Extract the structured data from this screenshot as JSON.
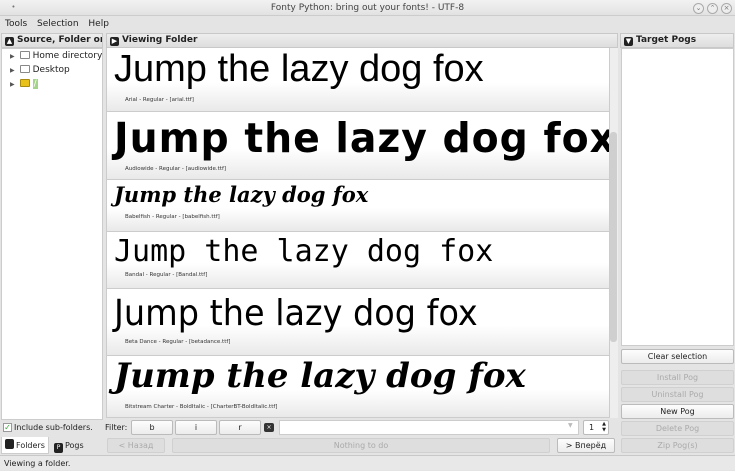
{
  "window": {
    "title": "Fonty Python: bring out your fonts!  -  UTF-8"
  },
  "menu": [
    "Tools",
    "Selection",
    "Help"
  ],
  "left": {
    "title": "Source, Folder or Pog",
    "tree": [
      "Home directory",
      "Desktop",
      "/"
    ],
    "include_subfolders": "Include sub-folders.",
    "include_checked": true,
    "tabs": [
      "Folders",
      "Pogs"
    ]
  },
  "center": {
    "title": "Viewing Folder",
    "sample_text": "Jump the lazy dog fox",
    "fonts": [
      {
        "caption": "Arial - Regular - [arial.ttf]"
      },
      {
        "caption": "Audiowide - Regular - [audiowide.ttf]"
      },
      {
        "caption": "Babelfish - Regular - [babelfish.ttf]"
      },
      {
        "caption": "Bandal - Regular - [Bandal.ttf]"
      },
      {
        "caption": "Beta Dance - Regular - [betadance.ttf]"
      },
      {
        "caption": "Bitstream Charter - BoldItalic - [CharterBT-BoldItalic.ttf]"
      }
    ],
    "filter": {
      "label": "Filter:",
      "b": "b",
      "i": "i",
      "r": "r",
      "value": "",
      "page": "1"
    },
    "nav": {
      "back": "< Назад",
      "status": "Nothing to do",
      "forward": "> Вперёд"
    }
  },
  "right": {
    "title": "Target Pogs",
    "buttons": [
      "Clear selection",
      "Install Pog",
      "Uninstall Pog",
      "New Pog",
      "Delete Pog",
      "Zip Pog(s)"
    ]
  },
  "status": "Viewing a folder."
}
